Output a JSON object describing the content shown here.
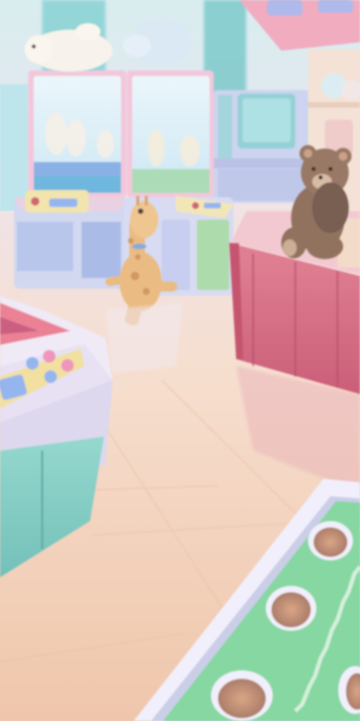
{
  "scene": {
    "background_theme": "pastel-arcade",
    "palette": {
      "floor_light": "#f6d9c2",
      "floor_mid": "#efc3a6",
      "wall": "#dfeef0",
      "teal": "#58c2c6",
      "claw_machine_body": "#d9d6ef",
      "claw_machine_trim": "#f3bcd3",
      "glass": "#e4f4fb",
      "red_counter": "#d8667d",
      "red_counter_dark": "#c24c66",
      "teddy_brown": "#8b6a57",
      "giraffe": "#e9b77c",
      "mint_cabinet": "#8fd3c7",
      "board_green": "#7fd59c",
      "board_frame": "#f1eefb",
      "hole": "#b68a78",
      "button_pink": "#f08fb7",
      "button_blue": "#8fb1ef"
    }
  },
  "objects": [
    {
      "id": "claw-machine-left",
      "type": "claw-machine"
    },
    {
      "id": "claw-machine-right",
      "type": "claw-machine"
    },
    {
      "id": "arcade-cabinets-back",
      "type": "arcade-cabinet-row"
    },
    {
      "id": "red-prize-counter",
      "type": "counter"
    },
    {
      "id": "teddy-bear",
      "type": "plush"
    },
    {
      "id": "giraffe-plush",
      "type": "plush"
    },
    {
      "id": "white-plush-on-top",
      "type": "plush"
    },
    {
      "id": "button-console-left",
      "type": "arcade-console"
    },
    {
      "id": "whack-board",
      "type": "game-board"
    }
  ]
}
